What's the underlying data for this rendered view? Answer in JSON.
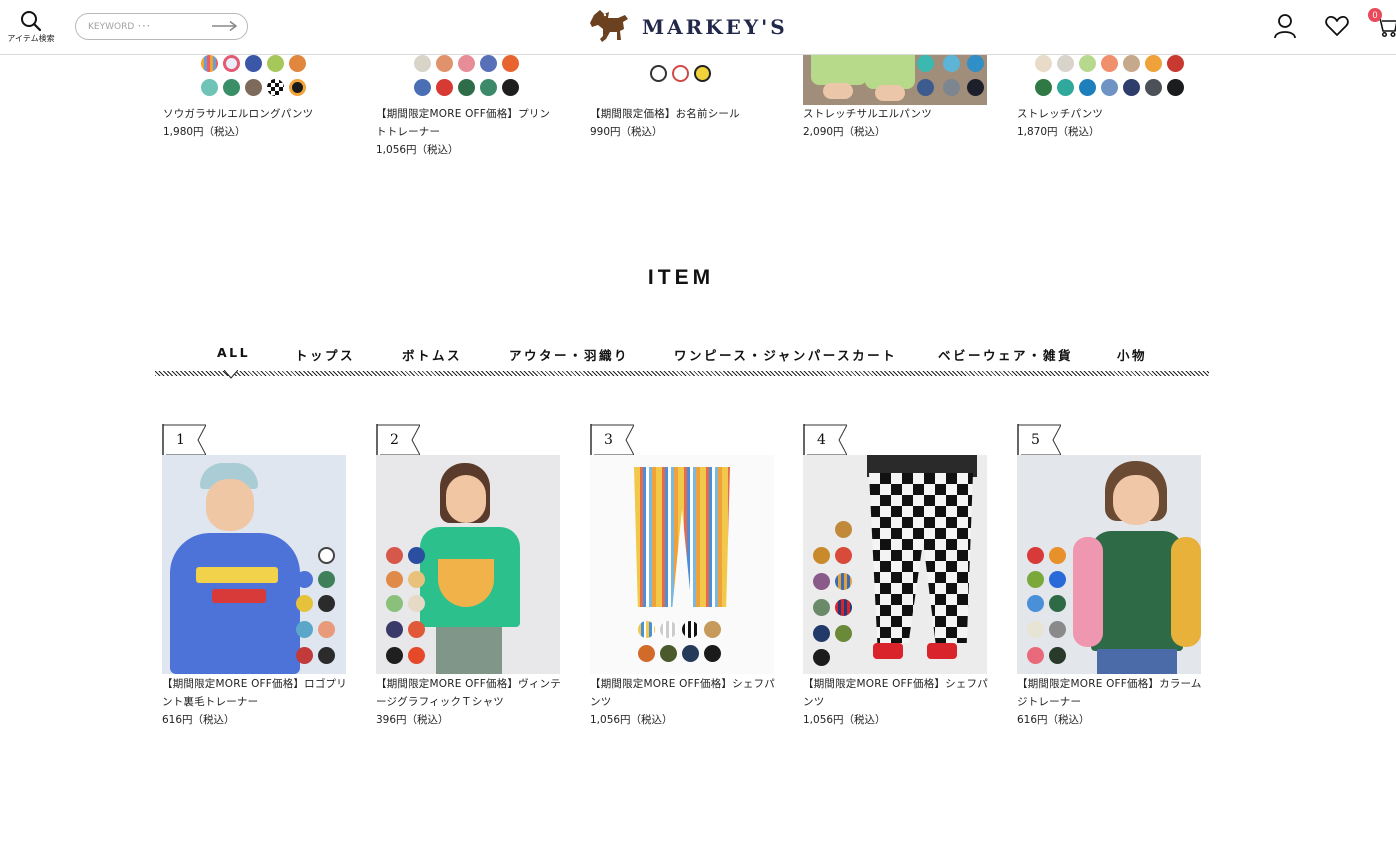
{
  "header": {
    "search_caption": "アイテム検索",
    "keyword_placeholder": "KEYWORD ･･･",
    "logo_text": "MARKEY'S",
    "cart_count": "0"
  },
  "top_row": [
    {
      "name": "ソウガラサルエルロングパンツ",
      "price": "1,980円（税込）"
    },
    {
      "name": "【期間限定MORE OFF価格】プリントトレーナー",
      "price": "1,056円（税込）"
    },
    {
      "name": "【期間限定価格】お名前シール",
      "price": "990円（税込）"
    },
    {
      "name": "ストレッチサルエルパンツ",
      "price": "2,090円（税込）"
    },
    {
      "name": "ストレッチパンツ",
      "price": "1,870円（税込）"
    }
  ],
  "item_section": {
    "title": "ITEM",
    "tabs": [
      "ALL",
      "トップス",
      "ボトムス",
      "アウター・羽織り",
      "ワンピース・ジャンパースカート",
      "ベビーウェア・雑貨",
      "小物"
    ],
    "active_tab": "ALL"
  },
  "ranking": [
    {
      "rank": "1",
      "name": "【期間限定MORE OFF価格】ロゴプリント裏毛トレーナー",
      "price": "616円（税込）"
    },
    {
      "rank": "2",
      "name": "【期間限定MORE OFF価格】ヴィンテージグラフィックＴシャツ",
      "price": "396円（税込）"
    },
    {
      "rank": "3",
      "name": "【期間限定MORE OFF価格】シェフパンツ",
      "price": "1,056円（税込）"
    },
    {
      "rank": "4",
      "name": "【期間限定MORE OFF価格】シェフパンツ",
      "price": "1,056円（税込）"
    },
    {
      "rank": "5",
      "name": "【期間限定MORE OFF価格】カラームジトレーナー",
      "price": "616円（税込）"
    }
  ],
  "colors": {
    "brand_navy": "#22284a",
    "cart_badge": "#e84a5c",
    "rule": "#222222"
  }
}
